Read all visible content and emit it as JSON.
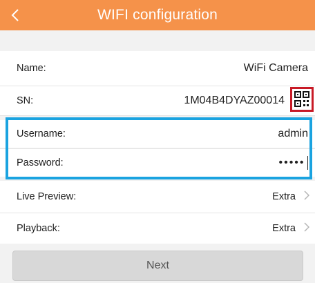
{
  "header": {
    "title": "WIFI configuration",
    "back_icon": "chevron-left-icon",
    "color": "#f5924a"
  },
  "form": {
    "name": {
      "label": "Name:",
      "value": "WiFi Camera"
    },
    "sn": {
      "label": "SN:",
      "value": "1M04B4DYAZ00014",
      "scan_icon": "qr-code-icon"
    },
    "username": {
      "label": "Username:",
      "value": "admin"
    },
    "password": {
      "label": "Password:",
      "value": "•••••"
    },
    "live_preview": {
      "label": "Live Preview:",
      "value": "Extra"
    },
    "playback": {
      "label": "Playback:",
      "value": "Extra"
    }
  },
  "highlight_colors": {
    "qr": "#c81a26",
    "credentials": "#1aa3e0"
  },
  "next_button": {
    "label": "Next"
  }
}
